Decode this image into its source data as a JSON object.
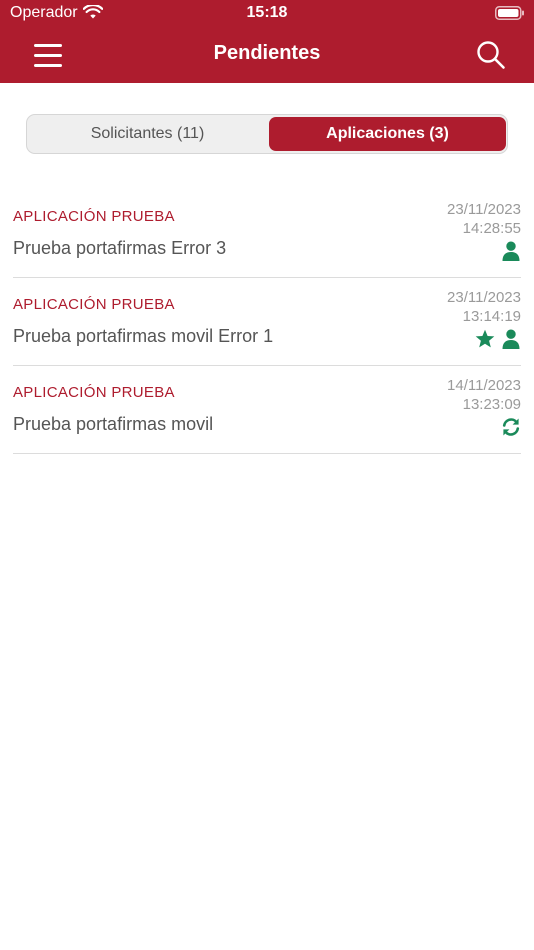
{
  "status_bar": {
    "carrier": "Operador",
    "time": "15:18"
  },
  "nav": {
    "title": "Pendientes",
    "menu_icon": "hamburger-menu-icon",
    "search_icon": "search-icon"
  },
  "tabs": [
    {
      "label": "Solicitantes (11)",
      "selected": false
    },
    {
      "label": "Aplicaciones (3)",
      "selected": true
    }
  ],
  "colors": {
    "brand": "#ae1c2e",
    "icon_green": "#1a8a5a"
  },
  "requests": [
    {
      "application": "APLICACIÓN PRUEBA",
      "subject": "Prueba portafirmas Error 3",
      "date": "23/11/2023",
      "time": "14:28:55",
      "icons": [
        "person-icon"
      ]
    },
    {
      "application": "APLICACIÓN PRUEBA",
      "subject": "Prueba portafirmas movil Error 1",
      "date": "23/11/2023",
      "time": "13:14:19",
      "icons": [
        "star-icon",
        "person-icon"
      ]
    },
    {
      "application": "APLICACIÓN PRUEBA",
      "subject": "Prueba portafirmas movil",
      "date": "14/11/2023",
      "time": "13:23:09",
      "icons": [
        "refresh-icon"
      ]
    }
  ]
}
